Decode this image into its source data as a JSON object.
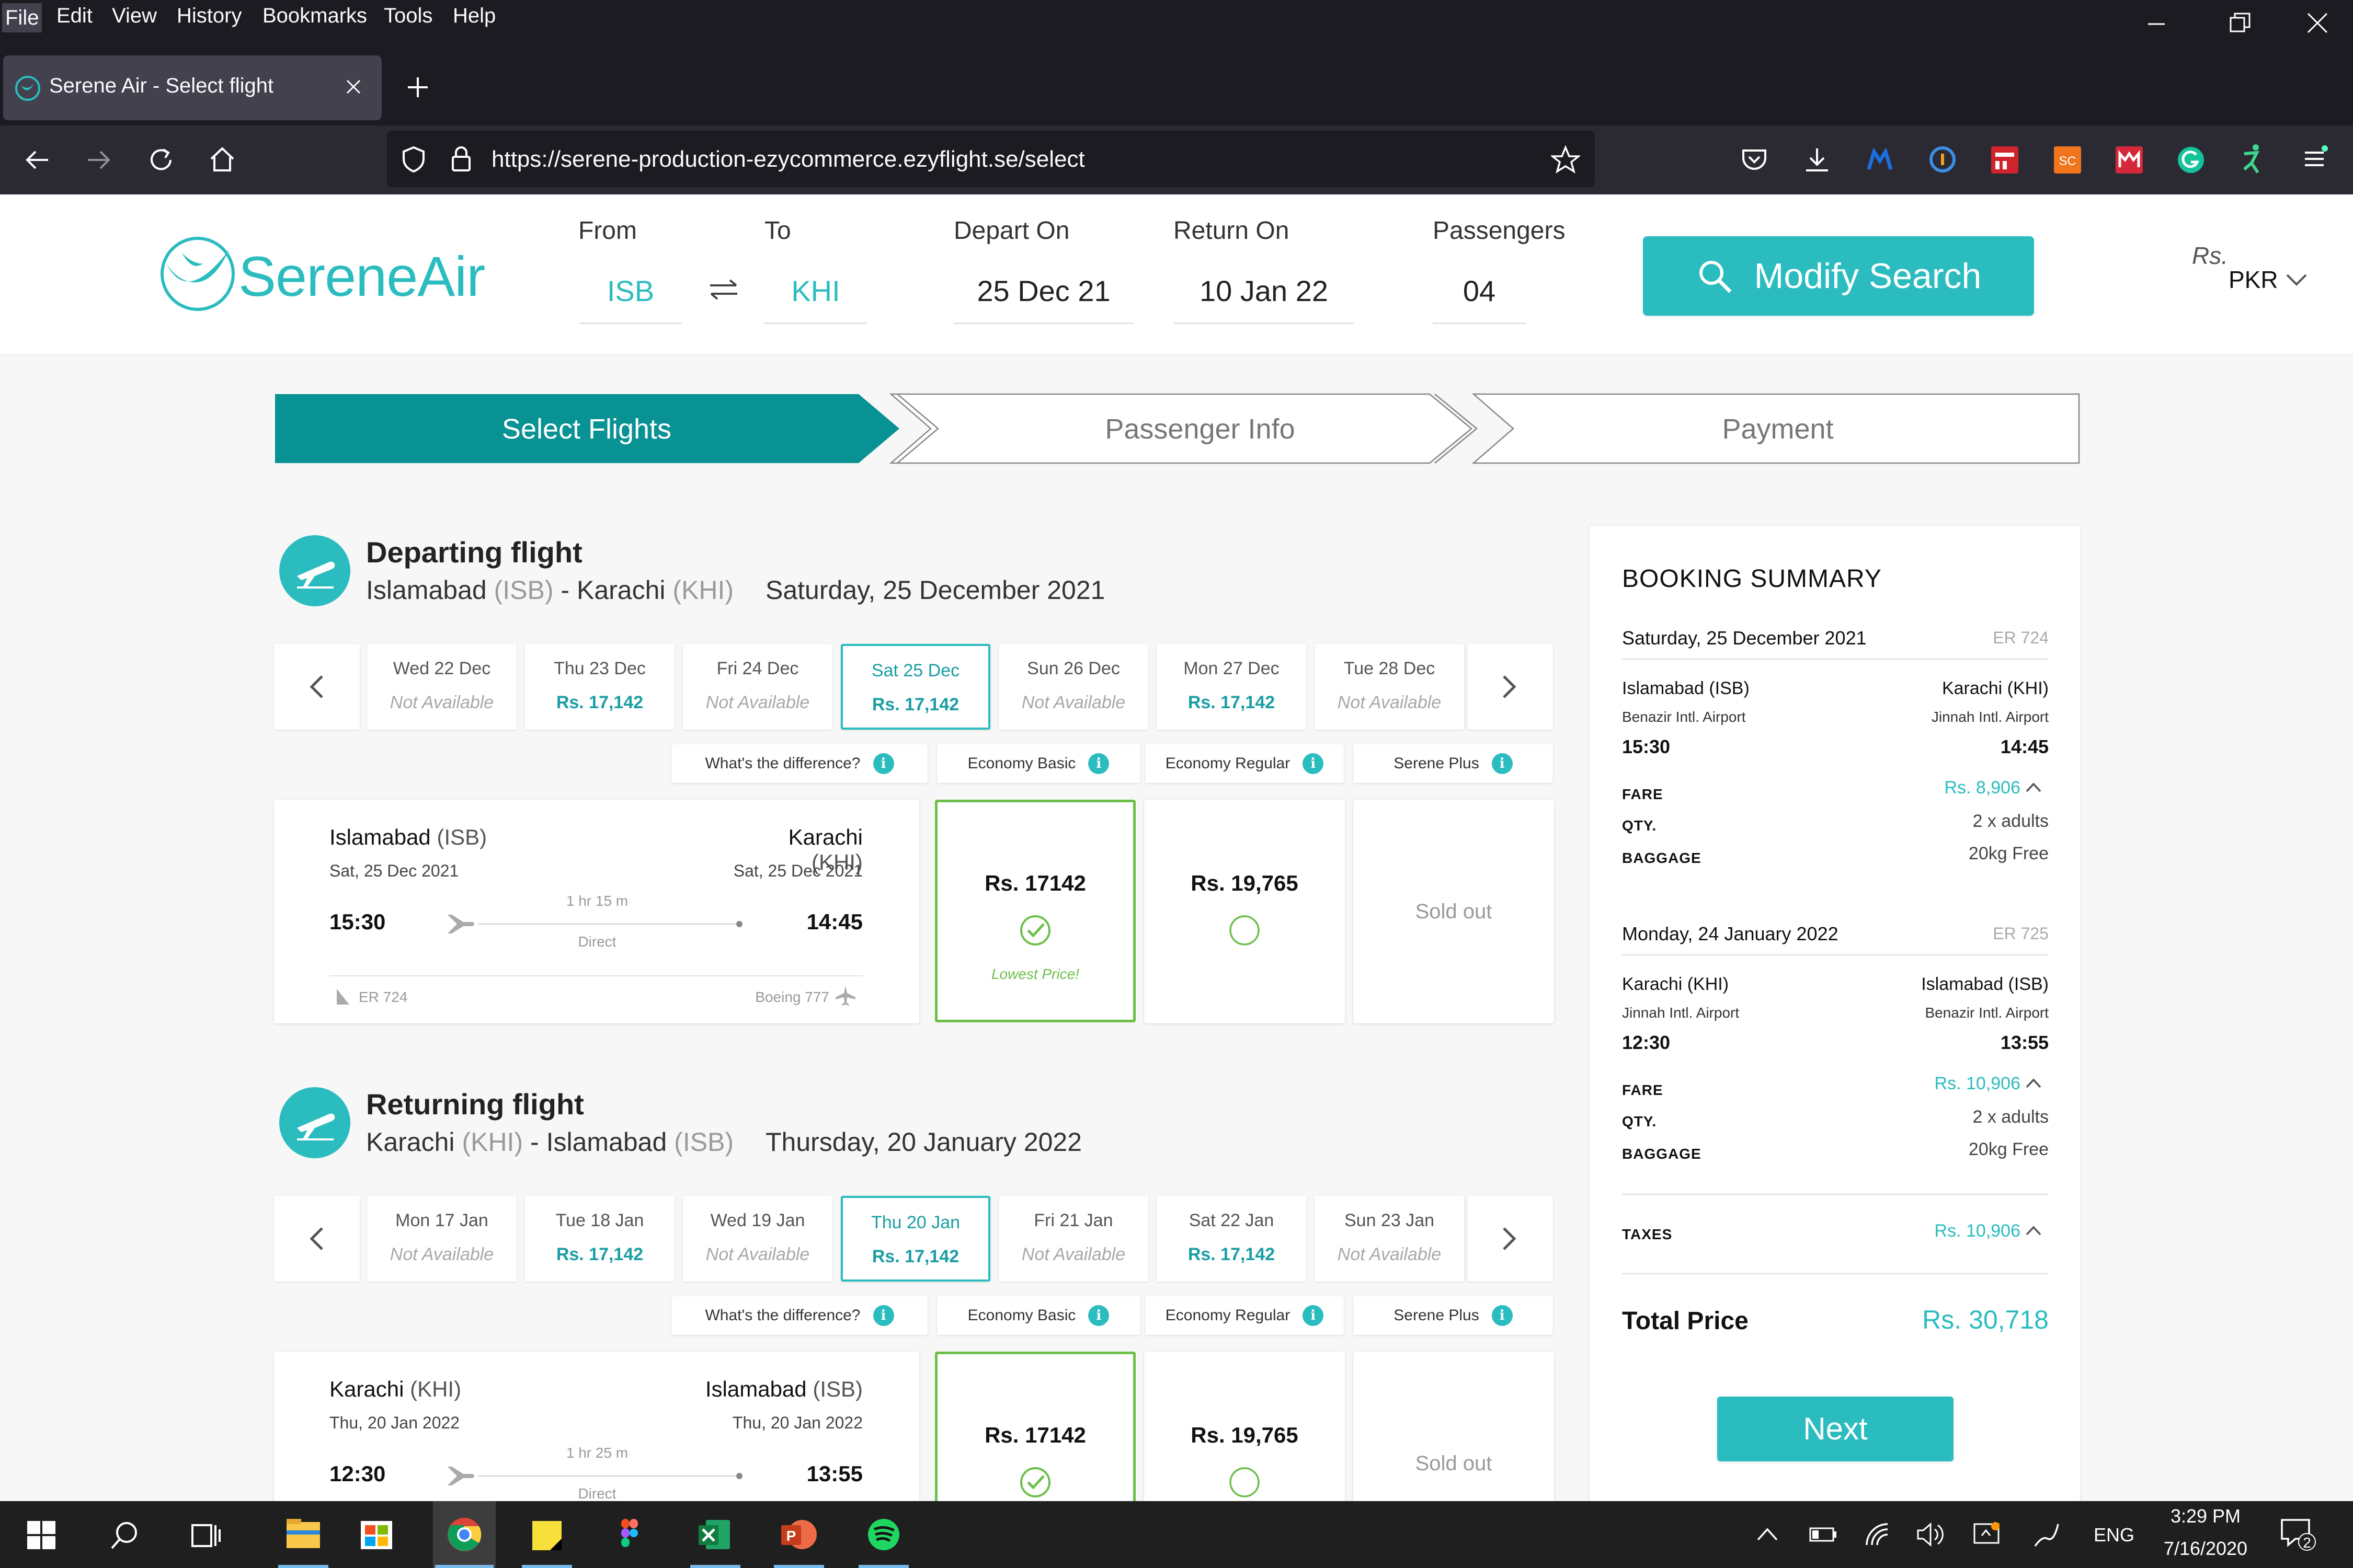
{
  "browser": {
    "menu": [
      "File",
      "Edit",
      "View",
      "History",
      "Bookmarks",
      "Tools",
      "Help"
    ],
    "tab_title": "Serene Air - Select flight",
    "url": "https://serene-production-ezycommerce.ezyflight.se/select"
  },
  "header": {
    "logo": "SereneAir",
    "from_label": "From",
    "from_value": "ISB",
    "to_label": "To",
    "to_value": "KHI",
    "depart_label": "Depart On",
    "depart_value": "25 Dec 21",
    "return_label": "Return On",
    "return_value": "10 Jan 22",
    "passengers_label": "Passengers",
    "passengers_value": "04",
    "modify_label": "Modify Search",
    "currency_symbol": "Rs.",
    "currency_code": "PKR"
  },
  "steps": [
    "Select Flights",
    "Passenger Info",
    "Payment"
  ],
  "departing": {
    "title": "Departing flight",
    "origin": "Islamabad",
    "origin_code": "(ISB)",
    "sep": "-",
    "destination": "Karachi",
    "destination_code": "(KHI)",
    "date_long": "Saturday, 25 December 2021",
    "dates": [
      {
        "label": "Wed 22 Dec",
        "price": "Not Available",
        "available": false,
        "selected": false
      },
      {
        "label": "Thu 23 Dec",
        "price": "Rs. 17,142",
        "available": true,
        "selected": false
      },
      {
        "label": "Fri 24 Dec",
        "price": "Not Available",
        "available": false,
        "selected": false
      },
      {
        "label": "Sat 25 Dec",
        "price": "Rs. 17,142",
        "available": true,
        "selected": true
      },
      {
        "label": "Sun 26 Dec",
        "price": "Not Available",
        "available": false,
        "selected": false
      },
      {
        "label": "Mon 27 Dec",
        "price": "Rs. 17,142",
        "available": true,
        "selected": false
      },
      {
        "label": "Tue 28 Dec",
        "price": "Not Available",
        "available": false,
        "selected": false
      }
    ],
    "classes": [
      "What's the difference?",
      "Economy Basic",
      "Economy Regular",
      "Serene Plus"
    ],
    "flight": {
      "from_city": "Islamabad",
      "from_code": "(ISB)",
      "from_date": "Sat, 25 Dec 2021",
      "from_time": "15:30",
      "to_city": "Karachi",
      "to_code": "(KHI)",
      "to_date": "Sat, 25 Dec 2021",
      "to_time": "14:45",
      "duration": "1 hr 15 m",
      "stops": "Direct",
      "flight_no": "ER 724",
      "aircraft": "Boeing 777"
    },
    "fares": {
      "basic": "Rs. 17142",
      "basic_note": "Lowest Price!",
      "regular": "Rs. 19,765",
      "plus": "Sold out"
    }
  },
  "returning": {
    "title": "Returning flight",
    "origin": "Karachi",
    "origin_code": "(KHI)",
    "sep": "-",
    "destination": "Islamabad",
    "destination_code": "(ISB)",
    "date_long": "Thursday, 20 January 2022",
    "dates": [
      {
        "label": "Mon 17 Jan",
        "price": "Not Available",
        "available": false,
        "selected": false
      },
      {
        "label": "Tue 18 Jan",
        "price": "Rs. 17,142",
        "available": true,
        "selected": false
      },
      {
        "label": "Wed 19 Jan",
        "price": "Not Available",
        "available": false,
        "selected": false
      },
      {
        "label": "Thu 20 Jan",
        "price": "Rs. 17,142",
        "available": true,
        "selected": true
      },
      {
        "label": "Fri 21 Jan",
        "price": "Not Available",
        "available": false,
        "selected": false
      },
      {
        "label": "Sat 22 Jan",
        "price": "Rs. 17,142",
        "available": true,
        "selected": false
      },
      {
        "label": "Sun 23 Jan",
        "price": "Not Available",
        "available": false,
        "selected": false
      }
    ],
    "classes": [
      "What's the difference?",
      "Economy Basic",
      "Economy Regular",
      "Serene Plus"
    ],
    "flight": {
      "from_city": "Karachi",
      "from_code": "(KHI)",
      "from_date": "Thu, 20 Jan 2022",
      "from_time": "12:30",
      "to_city": "Islamabad",
      "to_code": "(ISB)",
      "to_date": "Thu, 20 Jan 2022",
      "to_time": "13:55",
      "duration": "1 hr 25 m",
      "stops": "Direct"
    },
    "fares": {
      "basic": "Rs. 17142",
      "regular": "Rs. 19,765",
      "plus": "Sold out"
    }
  },
  "summary": {
    "title": "BOOKING SUMMARY",
    "outbound": {
      "date": "Saturday, 25 December 2021",
      "code": "ER 724",
      "from_city": "Islamabad (ISB)",
      "from_airport": "Benazir Intl. Airport",
      "from_time": "15:30",
      "to_city": "Karachi (KHI)",
      "to_airport": "Jinnah Intl. Airport",
      "to_time": "14:45",
      "fare_label": "FARE",
      "fare": "Rs. 8,906",
      "qty_label": "QTY.",
      "qty": "2 x adults",
      "baggage_label": "BAGGAGE",
      "baggage": "20kg Free"
    },
    "inbound": {
      "date": "Monday, 24 January 2022",
      "code": "ER 725",
      "from_city": "Karachi (KHI)",
      "from_airport": "Jinnah Intl. Airport",
      "from_time": "12:30",
      "to_city": "Islamabad (ISB)",
      "to_airport": "Benazir Intl. Airport",
      "to_time": "13:55",
      "fare_label": "FARE",
      "fare": "Rs. 10,906",
      "qty_label": "QTY.",
      "qty": "2 x adults",
      "baggage_label": "BAGGAGE",
      "baggage": "20kg Free"
    },
    "taxes_label": "TAXES",
    "taxes": "Rs. 10,906",
    "total_label": "Total Price",
    "total": "Rs. 30,718",
    "next_label": "Next"
  },
  "taskbar": {
    "lang": "ENG",
    "time": "3:29 PM",
    "date": "7/16/2020",
    "notifications": "2"
  },
  "colors": {
    "teal": "#2bbcbf",
    "green": "#6cc04a",
    "chrome_dark": "#1c1b22"
  }
}
